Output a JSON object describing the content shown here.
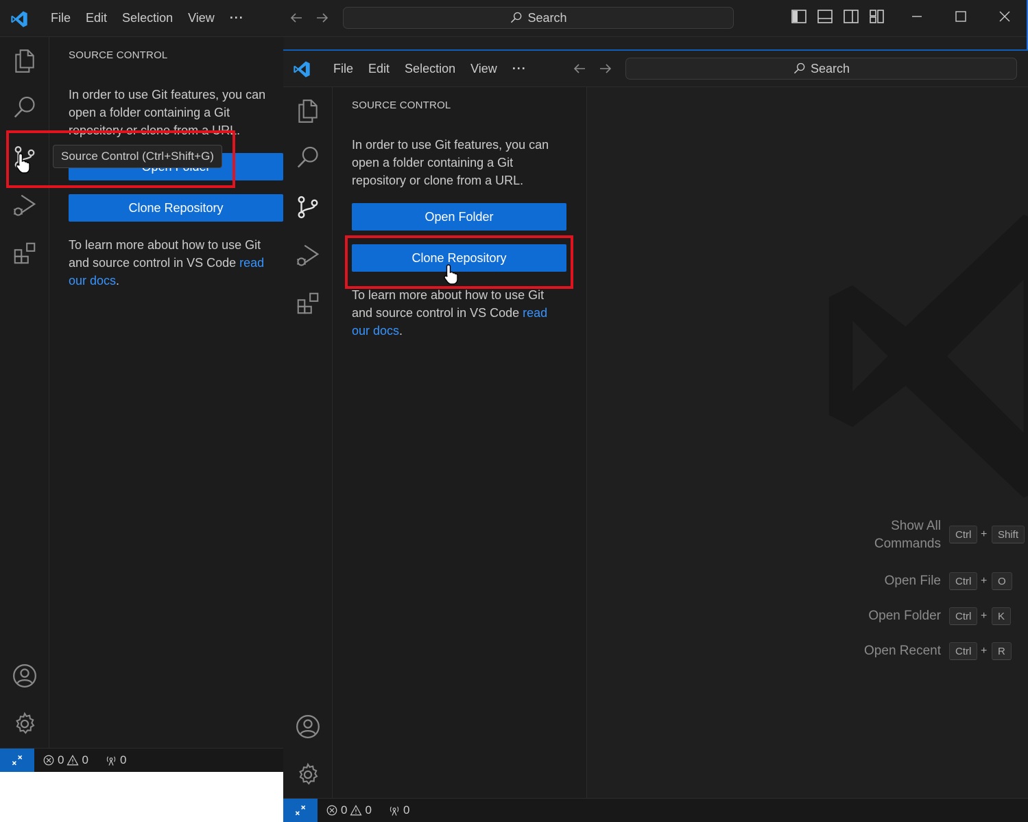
{
  "menu": {
    "file": "File",
    "edit": "Edit",
    "selection": "Selection",
    "view": "View",
    "more": "···"
  },
  "search": {
    "label": "Search"
  },
  "sidebar": {
    "title": "SOURCE CONTROL",
    "intro": "In order to use Git features, you can open a folder containing a Git repository or clone from a URL.",
    "open_folder": "Open Folder",
    "clone_repo": "Clone Repository",
    "learn_prefix": "To learn more about how to use Git and source control in VS Code ",
    "learn_link": "read our docs",
    "learn_suffix": "."
  },
  "tooltip": {
    "text": "Source Control (Ctrl+Shift+G)"
  },
  "status": {
    "errors": "0",
    "warnings": "0",
    "ports": "0"
  },
  "shortcuts": [
    {
      "label": "Show All Commands",
      "keys": [
        "Ctrl",
        "Shift"
      ]
    },
    {
      "label": "Open File",
      "keys": [
        "Ctrl",
        "O"
      ]
    },
    {
      "label": "Open Folder",
      "keys": [
        "Ctrl",
        "K"
      ]
    },
    {
      "label": "Open Recent",
      "keys": [
        "Ctrl",
        "R"
      ]
    }
  ],
  "icons": [
    "vscode-logo",
    "explorer-icon",
    "search-icon",
    "source-control-icon",
    "run-debug-icon",
    "extensions-icon",
    "account-icon",
    "settings-gear-icon",
    "remote-icon",
    "error-icon",
    "warning-icon",
    "ports-icon",
    "arrow-left-icon",
    "arrow-right-icon",
    "toggle-sidebar-icon",
    "toggle-panel-icon",
    "toggle-secondary-sidebar-icon",
    "customize-layout-icon",
    "minimize-icon",
    "maximize-icon",
    "close-icon"
  ],
  "colors": {
    "accent": "#0f6cd4",
    "highlight": "#e0141e",
    "link": "#3794ff"
  }
}
